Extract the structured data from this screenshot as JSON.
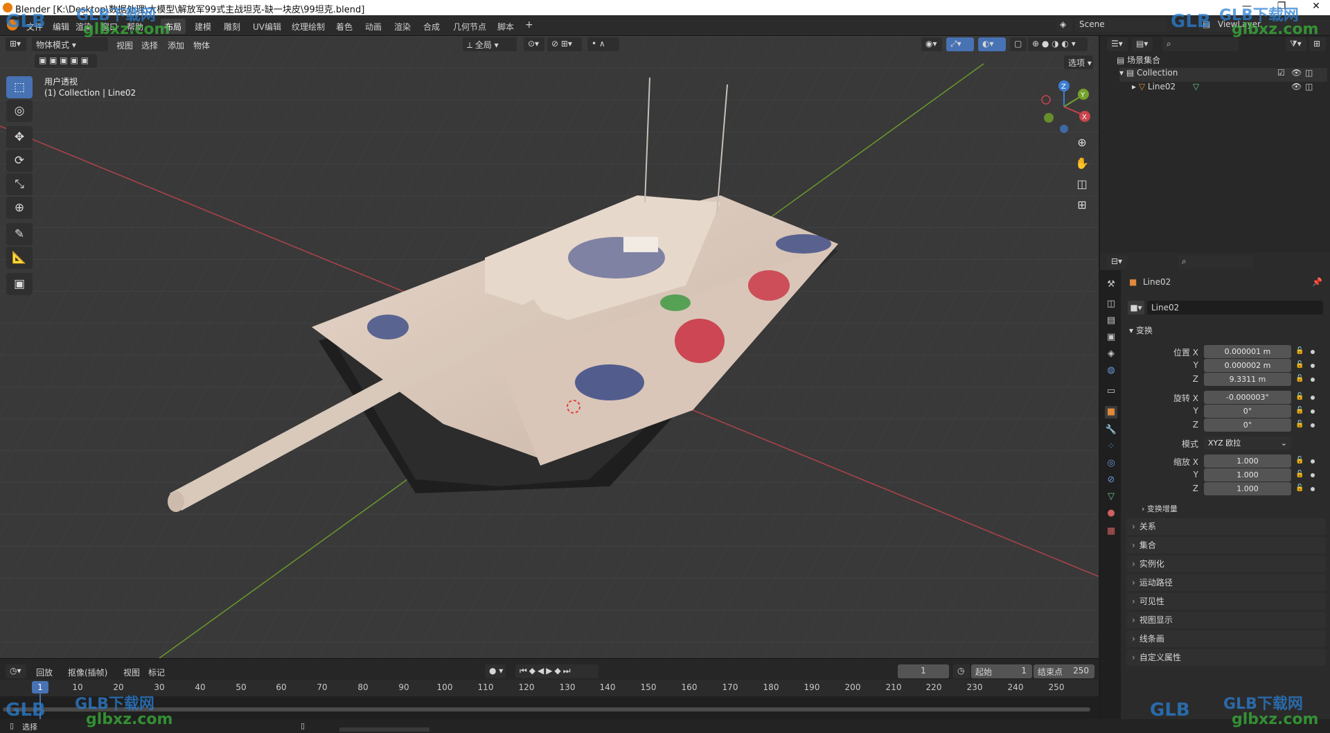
{
  "window": {
    "title": "Blender [K:\\Desktop\\数据处理\\大模型\\解放军99式主战坦克-缺一块皮\\99坦克.blend]",
    "minimize": "—",
    "maximize": "❐",
    "close": "✕"
  },
  "top_menu": [
    "文件",
    "编辑",
    "渲染",
    "窗口",
    "帮助"
  ],
  "workspaces": [
    "布局",
    "建模",
    "雕刻",
    "UV编辑",
    "纹理绘制",
    "着色",
    "动画",
    "渲染",
    "合成",
    "几何节点",
    "脚本"
  ],
  "workspace_add": "+",
  "scene": {
    "value": "Scene",
    "view_layer": "ViewLayer"
  },
  "viewport": {
    "mode": "物体模式",
    "menus": [
      "视图",
      "选择",
      "添加",
      "物体"
    ],
    "orientation": "全局",
    "options_label": "选项",
    "overlay_title": "用户透视",
    "overlay_sub": "(1) Collection | Line02",
    "gizmo": {
      "x": "X",
      "y": "Y",
      "z": "Z"
    }
  },
  "tools": [
    "select-box",
    "cursor",
    "move",
    "rotate",
    "scale",
    "transform",
    "annotate",
    "measure",
    "add-cube"
  ],
  "outliner": {
    "root": "场景集合",
    "collection": "Collection",
    "object": "Line02"
  },
  "properties": {
    "object_name": "Line02",
    "data_name": "Line02",
    "transform_header": "变换",
    "location_label": "位置 X",
    "location": [
      "0.000001 m",
      "0.000002 m",
      "9.3311 m"
    ],
    "rotation_label": "旋转 X",
    "rotation": [
      "-0.000003°",
      "0°",
      "0°"
    ],
    "mode_label": "模式",
    "mode_value": "XYZ 欧拉",
    "scale_label": "缩放 X",
    "scale": [
      "1.000",
      "1.000",
      "1.000"
    ],
    "axis_y": "Y",
    "axis_z": "Z",
    "delta_label": "变换增量",
    "panels": [
      "关系",
      "集合",
      "实例化",
      "运动路径",
      "可见性",
      "视图显示",
      "线条画",
      "自定义属性"
    ]
  },
  "timeline": {
    "menus": [
      "回放",
      "抠像(插帧)",
      "视图",
      "标记"
    ],
    "current_frame": "1",
    "start_label": "起始",
    "start_value": "1",
    "end_label": "结束点",
    "end_value": "250",
    "ruler": [
      "1",
      "10",
      "20",
      "30",
      "40",
      "50",
      "60",
      "70",
      "80",
      "90",
      "100",
      "110",
      "120",
      "130",
      "140",
      "150",
      "160",
      "170",
      "180",
      "190",
      "200",
      "210",
      "220",
      "230",
      "240",
      "250"
    ]
  },
  "status": {
    "left": "选择"
  },
  "watermarks": {
    "brand": "GLB下载网",
    "url": "glbxz.com",
    "logo": "GLB"
  },
  "colors": {
    "accent": "#4772b3",
    "x_axis": "#c9454c",
    "y_axis": "#76a12a",
    "z_axis": "#3d7ed4"
  }
}
